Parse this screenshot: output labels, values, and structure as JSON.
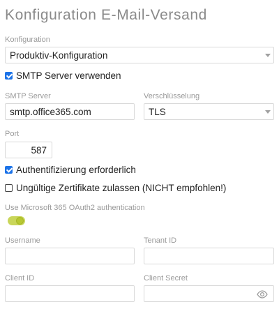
{
  "page": {
    "title": "Konfiguration E-Mail-Versand"
  },
  "konfiguration": {
    "label": "Konfiguration",
    "value": "Produktiv-Konfiguration"
  },
  "smtp_use": {
    "label": "SMTP Server verwenden",
    "checked": true
  },
  "smtp_server": {
    "label": "SMTP Server",
    "value": "smtp.office365.com"
  },
  "encryption": {
    "label": "Verschlüsselung",
    "value": "TLS"
  },
  "port": {
    "label": "Port",
    "value": "587"
  },
  "auth_required": {
    "label": "Authentifizierung erforderlich",
    "checked": true
  },
  "invalid_certs": {
    "label": "Ungültige Zertifikate zulassen (NICHT empfohlen!)",
    "checked": false
  },
  "oauth": {
    "label": "Use Microsoft 365 OAuth2 authentication",
    "enabled": true
  },
  "username": {
    "label": "Username",
    "value": ""
  },
  "tenant_id": {
    "label": "Tenant ID",
    "value": ""
  },
  "client_id": {
    "label": "Client ID",
    "value": ""
  },
  "client_secret": {
    "label": "Client Secret",
    "value": "",
    "icon": "eye-icon"
  },
  "colors": {
    "accent": "#1c73e8",
    "toggle_on": "#c9d65a",
    "label": "#9a9a9a"
  }
}
